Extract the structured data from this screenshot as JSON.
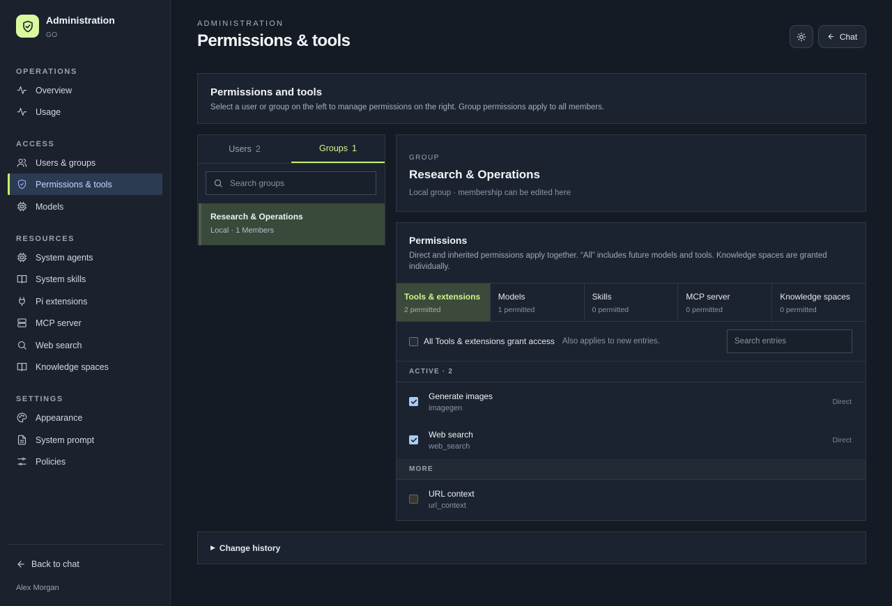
{
  "brand": {
    "title": "Administration",
    "subtitle": "GO"
  },
  "sidebar": {
    "sections": [
      {
        "title": "OPERATIONS",
        "items": [
          {
            "label": "Overview",
            "icon": "activity-icon"
          },
          {
            "label": "Usage",
            "icon": "activity-icon"
          }
        ]
      },
      {
        "title": "ACCESS",
        "items": [
          {
            "label": "Users & groups",
            "icon": "users-icon"
          },
          {
            "label": "Permissions & tools",
            "icon": "shield-icon"
          },
          {
            "label": "Models",
            "icon": "cpu-icon"
          }
        ]
      },
      {
        "title": "RESOURCES",
        "items": [
          {
            "label": "System agents",
            "icon": "cpu-icon"
          },
          {
            "label": "System skills",
            "icon": "book-icon"
          },
          {
            "label": "Pi extensions",
            "icon": "plug-icon"
          },
          {
            "label": "MCP server",
            "icon": "server-icon"
          },
          {
            "label": "Web search",
            "icon": "search-icon"
          },
          {
            "label": "Knowledge spaces",
            "icon": "book-icon"
          }
        ]
      },
      {
        "title": "SETTINGS",
        "items": [
          {
            "label": "Appearance",
            "icon": "palette-icon"
          },
          {
            "label": "System prompt",
            "icon": "file-icon"
          },
          {
            "label": "Policies",
            "icon": "sliders-icon"
          }
        ]
      }
    ],
    "active_item": "Permissions & tools",
    "back_label": "Back to chat",
    "user_name": "Alex Morgan"
  },
  "header": {
    "eyebrow": "ADMINISTRATION",
    "title": "Permissions & tools",
    "chat_label": "Chat"
  },
  "intro": {
    "title": "Permissions and tools",
    "description": "Select a user or group on the left to manage permissions on the right. Group permissions apply to all members."
  },
  "left_panel": {
    "tabs": [
      {
        "label": "Users",
        "count": "2"
      },
      {
        "label": "Groups",
        "count": "1"
      }
    ],
    "active_tab": "Groups",
    "search_placeholder": "Search groups",
    "groups": [
      {
        "name": "Research & Operations",
        "meta": "Local · 1 Members"
      }
    ]
  },
  "group": {
    "label": "GROUP",
    "name": "Research & Operations",
    "meta": "Local group · membership can be edited here"
  },
  "permissions": {
    "title": "Permissions",
    "description": "Direct and inherited permissions apply together. “All” includes future models and tools. Knowledge spaces are granted individually.",
    "tabs": [
      {
        "name": "Tools & extensions",
        "sub": "2 permitted"
      },
      {
        "name": "Models",
        "sub": "1 permitted"
      },
      {
        "name": "Skills",
        "sub": "0 permitted"
      },
      {
        "name": "MCP server",
        "sub": "0 permitted"
      },
      {
        "name": "Knowledge spaces",
        "sub": "0 permitted"
      }
    ],
    "active_tab": "Tools & extensions",
    "all_label": "All Tools & extensions grant access",
    "all_hint": "Also applies to new entries.",
    "all_checked": false,
    "entry_search_placeholder": "Search entries",
    "active_section_label": "ACTIVE · 2",
    "active_entries": [
      {
        "name": "Generate images",
        "code": "imagegen",
        "source": "Direct",
        "checked": true
      },
      {
        "name": "Web search",
        "code": "web_search",
        "source": "Direct",
        "checked": true
      }
    ],
    "more_section_label": "MORE",
    "more_entries": [
      {
        "name": "URL context",
        "code": "url_context",
        "checked": false
      }
    ]
  },
  "history": {
    "label": "Change history"
  },
  "colors": {
    "accent": "#c6f26b",
    "brand_logo": "#d9f99d",
    "background": "#151b24",
    "panel": "#1b2330",
    "check": "#a8cdf5"
  }
}
